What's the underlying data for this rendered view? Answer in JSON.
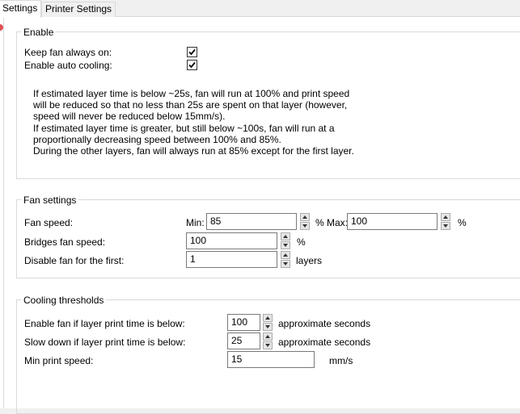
{
  "tabs": {
    "settings": "Settings",
    "printer_settings": "Printer Settings"
  },
  "enable": {
    "title": "Enable",
    "keep_fan_label": "Keep fan always on:",
    "keep_fan_checked": true,
    "auto_cooling_label": "Enable auto cooling:",
    "auto_cooling_checked": true,
    "info_lines": [
      "If estimated layer time is below ~25s, fan will run at 100% and print speed",
      "will be reduced so that no less than 25s are spent on that layer (however,",
      "speed will never be reduced below 15mm/s).",
      "If estimated layer time is greater, but still below ~100s, fan will run at a",
      "proportionally decreasing speed between 100% and 85%.",
      "During the other layers, fan will always run at 85% except for the first layer."
    ]
  },
  "fan_settings": {
    "title": "Fan settings",
    "fan_speed_label": "Fan speed:",
    "min_label": "Min:",
    "min_value": "85",
    "percent_max_label": "% Max:",
    "max_value": "100",
    "percent": "%",
    "bridges_label": "Bridges fan speed:",
    "bridges_value": "100",
    "disable_label": "Disable fan for the first:",
    "disable_value": "1",
    "layers": "layers"
  },
  "cooling": {
    "title": "Cooling thresholds",
    "enable_fan_label": "Enable fan if layer print time is below:",
    "enable_fan_value": "100",
    "slow_down_label": "Slow down if layer print time is below:",
    "slow_down_value": "25",
    "approx_seconds": "approximate seconds",
    "min_speed_label": "Min print speed:",
    "min_speed_value": "15",
    "mms": "mm/s"
  }
}
